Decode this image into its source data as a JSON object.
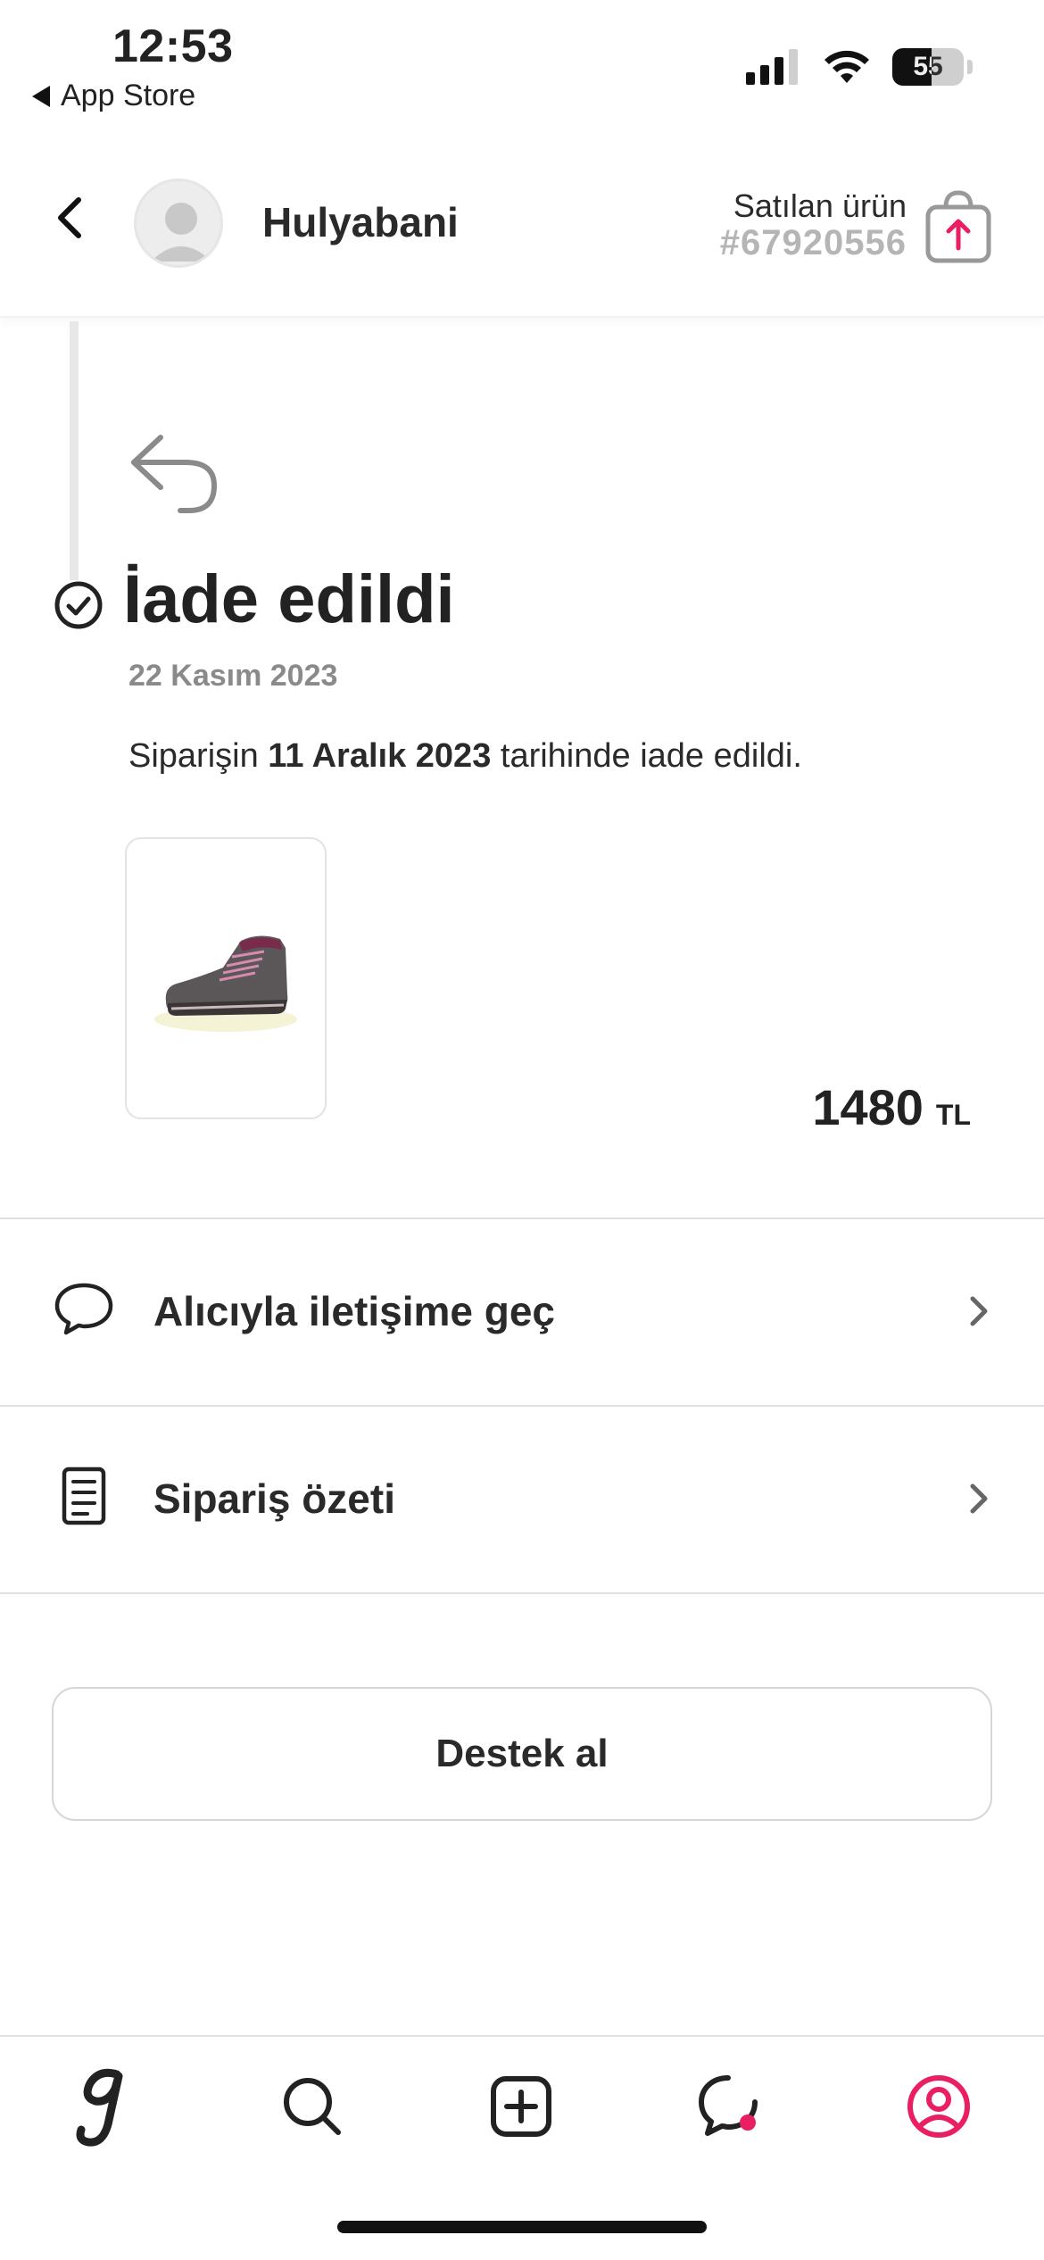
{
  "status_bar": {
    "time": "12:53",
    "back_app": "App Store",
    "battery": "55"
  },
  "header": {
    "seller_name": "Hulyabani",
    "sold_label": "Satılan ürün",
    "order_id": "#67920556"
  },
  "status": {
    "title": "İade edildi",
    "date": "22 Kasım 2023",
    "desc_prefix": "Siparişin ",
    "desc_date": "11 Aralık 2023",
    "desc_suffix": " tarihinde iade edildi."
  },
  "product": {
    "price": "1480",
    "currency": "TL"
  },
  "actions": [
    {
      "label": "Alıcıyla iletişime geç",
      "icon": "chat-bubble-icon"
    },
    {
      "label": "Sipariş özeti",
      "icon": "receipt-icon"
    }
  ],
  "support": {
    "label": "Destek al"
  },
  "tabs": [
    {
      "name": "home",
      "icon": "logo-g-icon"
    },
    {
      "name": "search",
      "icon": "search-icon"
    },
    {
      "name": "add",
      "icon": "plus-square-icon"
    },
    {
      "name": "messages",
      "icon": "message-icon"
    },
    {
      "name": "profile",
      "icon": "profile-icon"
    }
  ],
  "colors": {
    "accent": "#e91e63",
    "text": "#222222",
    "muted": "#8a8a8a"
  }
}
